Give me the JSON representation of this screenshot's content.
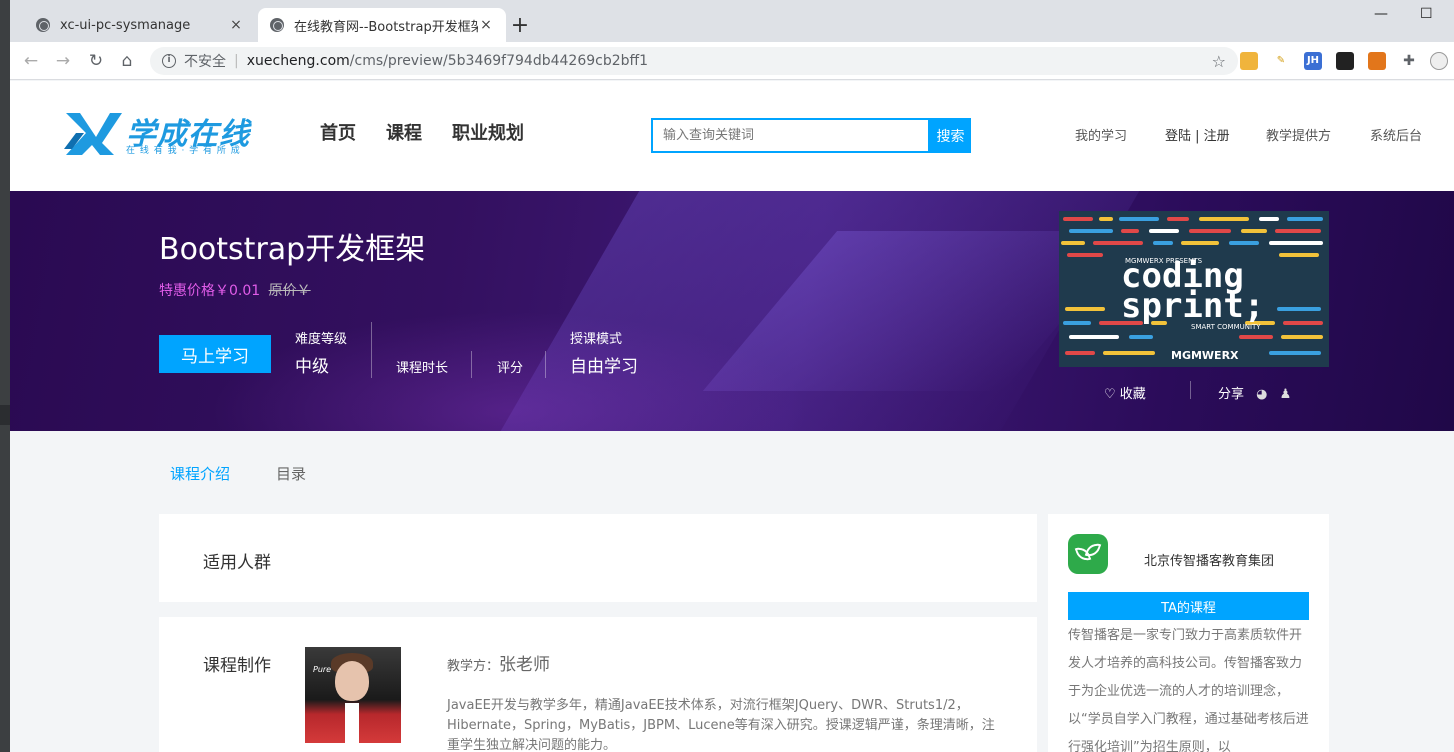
{
  "browser": {
    "tabs": [
      {
        "title": "xc-ui-pc-sysmanage",
        "close": "×"
      },
      {
        "title": "在线教育网--Bootstrap开发框架",
        "close": "×"
      }
    ],
    "new_tab": "+",
    "window_controls": {
      "minimize": "—",
      "maximize": "☐"
    },
    "nav": {
      "back": "←",
      "forward": "→",
      "reload": "↻",
      "home": "⌂"
    },
    "address": {
      "security_label": "不安全",
      "host": "xuecheng.com",
      "path": "/cms/preview/5b3469f794db44269cb2bff1",
      "star": "☆"
    },
    "extensions": [
      "cat-extension-icon",
      "broom-extension-icon",
      "jh-extension-icon",
      "mask-extension-icon",
      "fox-extension-icon",
      "puzzle-extension-icon",
      "profile-avatar"
    ],
    "extension_labels": {
      "jh": "JH"
    }
  },
  "site": {
    "logo_text": "学成在线",
    "logo_slogan": "在 线 有 我 · 学 有 所 成",
    "nav": [
      "首页",
      "课程",
      "职业规划"
    ],
    "search": {
      "placeholder": "输入查询关键词",
      "button": "搜索"
    },
    "user_nav": {
      "my_learning": "我的学习",
      "login": "登陆 | 注册",
      "provider": "教学提供方",
      "admin": "系统后台"
    }
  },
  "course": {
    "title": "Bootstrap开发框架",
    "price_label": "特惠价格￥0.01",
    "original_price": "原价￥",
    "learn_button": "马上学习",
    "difficulty_label": "难度等级",
    "difficulty_value": "中级",
    "duration_label": "课程时长",
    "rating_label": "评分",
    "mode_label": "授课模式",
    "mode_value": "自由学习",
    "favorite": "收藏",
    "share": "分享",
    "thumbnail": {
      "presents": "MGMWERX PRESENTS",
      "line1": "coding",
      "line2": "sprint;",
      "community": "SMART COMMUNITY",
      "brand": "MGMWERX"
    }
  },
  "tabs": [
    "课程介绍",
    "目录"
  ],
  "sections": {
    "audience_title": "适用人群",
    "production_title": "课程制作",
    "teacher_prefix": "教学方：",
    "teacher_name": "张老师",
    "teacher_photo_text": "Pure",
    "teacher_desc": "JavaEE开发与教学多年，精通JavaEE技术体系，对流行框架JQuery、DWR、Struts1/2，Hibernate，Spring，MyBatis，JBPM、Lucene等有深入研究。授课逻辑严谨，条理清晰，注重学生独立解决问题的能力。"
  },
  "org": {
    "name": "北京传智播客教育集团",
    "courses_button": "TA的课程",
    "desc": "传智播客是一家专门致力于高素质软件开发人才培养的高科技公司。传智播客致力于为企业优选一流的人才的培训理念，以“学员自学入门教程，通过基础考核后进行强化培训”为招生原则，以"
  },
  "colors": {
    "accent": "#00a4ff",
    "price": "#e05ce8",
    "banner": "#33105f"
  }
}
